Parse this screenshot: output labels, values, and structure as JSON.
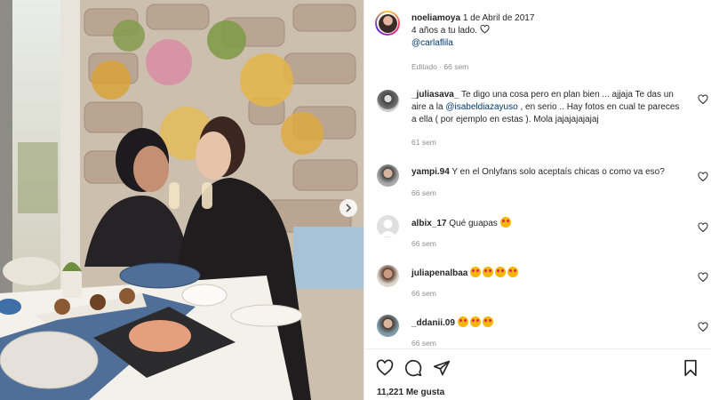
{
  "post": {
    "author": "noeliamoya",
    "date": "1 de Abril de 2017",
    "caption": "4 años a tu lado.",
    "caption_icon": "heart-outline-icon",
    "mention": "@carlaflila",
    "edited": "Editado · 66 sem"
  },
  "comments": [
    {
      "user": "_juliasava_",
      "text_before": " Te digo una cosa pero en plan bien ... ajjaja Te das un aire a la ",
      "mention": "@isabeldiazayuso",
      "text_after": " , en serio .. Hay fotos en cual te pareces a ella ( por ejemplo en estas ). Mola jajajajajajaj",
      "time": "61 sem"
    },
    {
      "user": "yampi.94",
      "text": " Y en el Onlyfans solo aceptaís chicas o como va eso?",
      "time": "66 sem"
    },
    {
      "user": "albix_17",
      "text": " Qué guapas",
      "emoji_count": 1,
      "time": "66 sem"
    },
    {
      "user": "juliapenalbaa",
      "text": " ",
      "emoji_count": 4,
      "time": "66 sem"
    },
    {
      "user": "_ddanii.09",
      "text": " ",
      "emoji_count": 3,
      "time": "66 sem"
    }
  ],
  "actions": {
    "like": "heart-icon",
    "comment": "comment-icon",
    "share": "paper-plane-icon",
    "save": "bookmark-icon"
  },
  "likes": "11,221 Me gusta",
  "colors": {
    "link": "#00376b",
    "muted": "#8e8e8e",
    "text": "#262626"
  }
}
